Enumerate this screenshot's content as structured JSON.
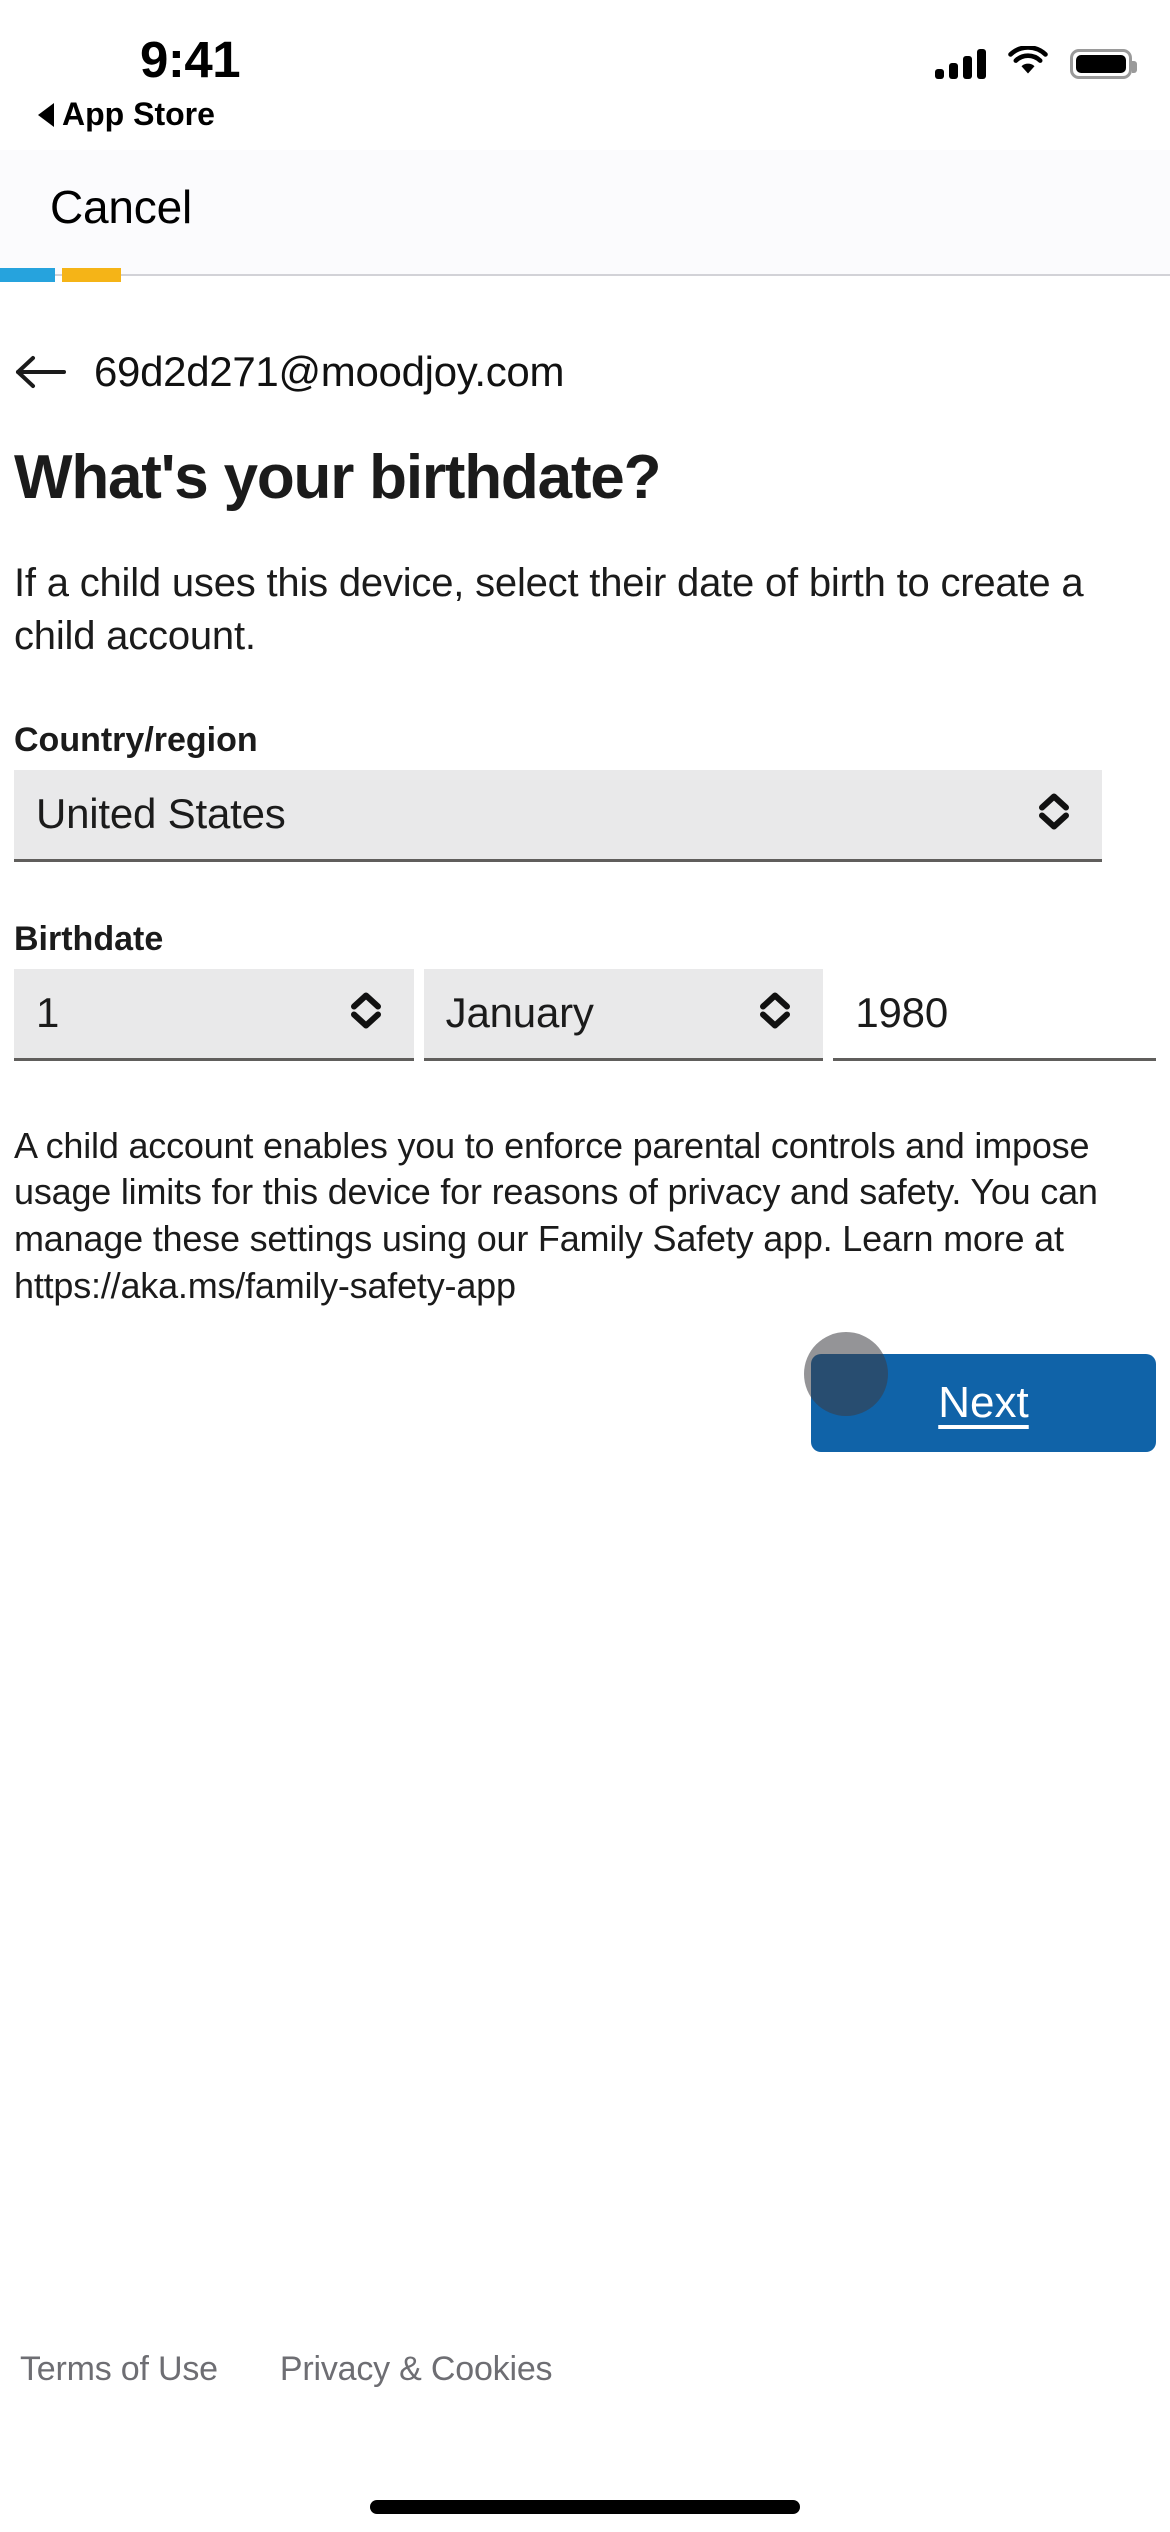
{
  "status_bar": {
    "time": "9:41",
    "back_app_label": "App Store",
    "icons": [
      "cellular-signal-icon",
      "wifi-icon",
      "battery-icon"
    ]
  },
  "nav": {
    "cancel_label": "Cancel"
  },
  "progress": {
    "segment_1_color": "#26a3dd",
    "segment_2_color": "#f5b417"
  },
  "account": {
    "back_icon": "arrow-left-icon",
    "email": "69d2d271@moodjoy.com"
  },
  "main": {
    "title": "What's your birthdate?",
    "lede": "If a child uses this device, select their date of birth to create a child account.",
    "country_label": "Country/region",
    "country_value": "United States",
    "birthdate_label": "Birthdate",
    "day_value": "1",
    "month_value": "January",
    "year_value": "1980",
    "disclaimer": "A child account enables you to enforce parental controls and impose usage limits for this device for reasons of privacy and safety. You can manage these settings using our Family Safety app. Learn more at https://aka.ms/family-safety-app",
    "next_label": "Next",
    "accent_color": "#1063a8"
  },
  "footer": {
    "terms_label": "Terms of Use",
    "privacy_label": "Privacy & Cookies"
  }
}
